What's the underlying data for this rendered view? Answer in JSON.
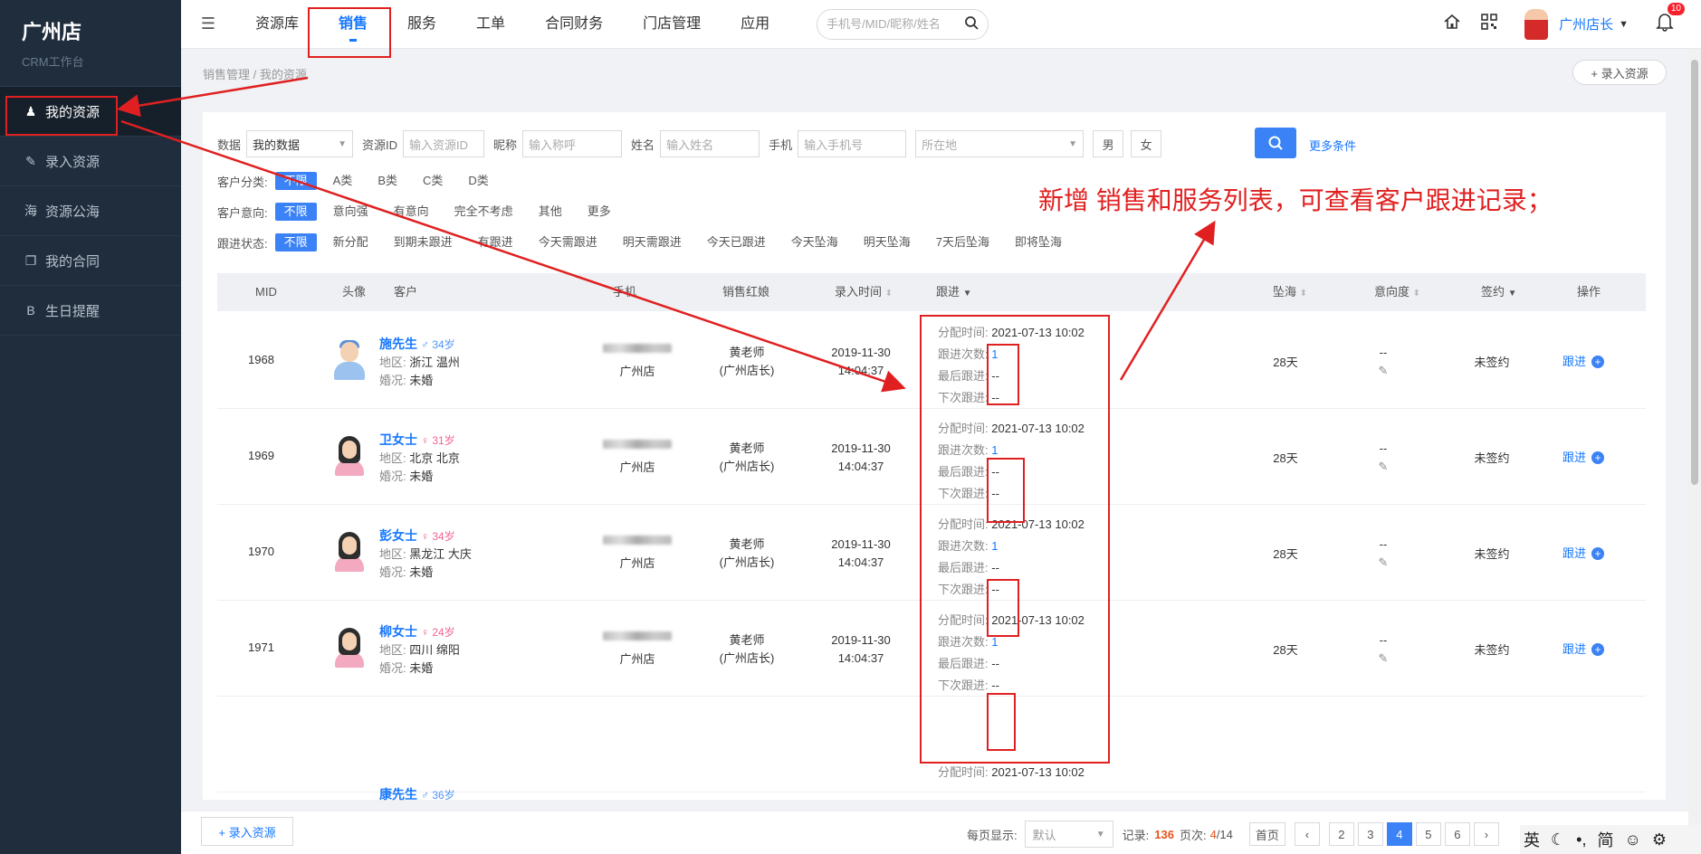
{
  "brand": {
    "title": "广州店",
    "subtitle": "CRM工作台"
  },
  "sidebar": {
    "items": [
      {
        "label": "我的资源",
        "icon": "user-icon",
        "glyph": "♟"
      },
      {
        "label": "录入资源",
        "icon": "edit-icon",
        "glyph": "✎"
      },
      {
        "label": "资源公海",
        "icon": "sea-icon",
        "glyph": "海"
      },
      {
        "label": "我的合同",
        "icon": "contract-icon",
        "glyph": "❐"
      },
      {
        "label": "生日提醒",
        "icon": "birthday-icon",
        "glyph": "B"
      }
    ]
  },
  "topnav": {
    "tabs": [
      "资源库",
      "销售",
      "服务",
      "工单",
      "合同财务",
      "门店管理",
      "应用"
    ],
    "search_placeholder": "手机号/MID/昵称/姓名",
    "user_name": "广州店长",
    "notification_count": "10"
  },
  "breadcrumb": "销售管理 / 我的资源",
  "add_resource_top": "+ 录入资源",
  "filters": {
    "data_label": "数据",
    "data_value": "我的数据",
    "resource_id_label": "资源ID",
    "resource_id_placeholder": "输入资源ID",
    "nickname_label": "昵称",
    "nickname_placeholder": "输入称呼",
    "name_label": "姓名",
    "name_placeholder": "输入姓名",
    "phone_label": "手机",
    "phone_placeholder": "输入手机号",
    "location_placeholder": "所在地",
    "male": "男",
    "female": "女",
    "more": "更多条件",
    "category_label": "客户分类:",
    "categories": [
      "不限",
      "A类",
      "B类",
      "C类",
      "D类"
    ],
    "intent_label": "客户意向:",
    "intents": [
      "不限",
      "意向强",
      "有意向",
      "完全不考虑",
      "其他",
      "更多"
    ],
    "status_label": "跟进状态:",
    "statuses": [
      "不限",
      "新分配",
      "到期未跟进",
      "有跟进",
      "今天需跟进",
      "明天需跟进",
      "今天已跟进",
      "今天坠海",
      "明天坠海",
      "7天后坠海",
      "即将坠海"
    ]
  },
  "table": {
    "headers": {
      "mid": "MID",
      "avatar": "头像",
      "customer": "客户",
      "phone": "手机",
      "sales": "销售红娘",
      "entry_time": "录入时间",
      "follow": "跟进",
      "sea": "坠海",
      "intent": "意向度",
      "sign": "签约",
      "ops": "操作"
    },
    "region_label": "地区:",
    "marital_label": "婚况:",
    "follow_labels": {
      "assigned": "分配时间:",
      "count": "跟进次数:",
      "last": "最后跟进:",
      "next": "下次跟进:"
    },
    "op_label": "跟进",
    "rows": [
      {
        "mid": "1968",
        "gender": "m",
        "name": "施先生",
        "age": "♂ 34岁",
        "region": "浙江 温州",
        "marital": "未婚",
        "store": "广州店",
        "sales": "黄老师",
        "sales_role": "(广州店长)",
        "date": "2019-11-30",
        "time": "14:04:37",
        "assigned": "2021-07-13 10:02",
        "count": "1",
        "last": "--",
        "next": "--",
        "sea": "28天",
        "intent": "--",
        "sign": "未签约"
      },
      {
        "mid": "1969",
        "gender": "f",
        "name": "卫女士",
        "age": "♀ 31岁",
        "region": "北京 北京",
        "marital": "未婚",
        "store": "广州店",
        "sales": "黄老师",
        "sales_role": "(广州店长)",
        "date": "2019-11-30",
        "time": "14:04:37",
        "assigned": "2021-07-13 10:02",
        "count": "1",
        "last": "--",
        "next": "--",
        "sea": "28天",
        "intent": "--",
        "sign": "未签约"
      },
      {
        "mid": "1970",
        "gender": "f",
        "name": "彭女士",
        "age": "♀ 34岁",
        "region": "黑龙江 大庆",
        "marital": "未婚",
        "store": "广州店",
        "sales": "黄老师",
        "sales_role": "(广州店长)",
        "date": "2019-11-30",
        "time": "14:04:37",
        "assigned": "2021-07-13 10:02",
        "count": "1",
        "last": "--",
        "next": "--",
        "sea": "28天",
        "intent": "--",
        "sign": "未签约"
      },
      {
        "mid": "1971",
        "gender": "f",
        "name": "柳女士",
        "age": "♀ 24岁",
        "region": "四川 绵阳",
        "marital": "未婚",
        "store": "广州店",
        "sales": "黄老师",
        "sales_role": "(广州店长)",
        "date": "2019-11-30",
        "time": "14:04:37",
        "assigned": "2021-07-13 10:02",
        "count": "1",
        "last": "--",
        "next": "--",
        "sea": "28天",
        "intent": "--",
        "sign": "未签约"
      },
      {
        "mid": "",
        "gender": "m",
        "name": "康先生",
        "age": "♂ 36岁",
        "assigned": "2021-07-13 10:02"
      }
    ]
  },
  "footer": {
    "add_resource": "+ 录入资源",
    "per_page_label": "每页显示:",
    "per_page_value": "默认",
    "records_label": "记录:",
    "records_value": "136",
    "page_label": "页次:",
    "page_current": "4",
    "page_total": "/14",
    "first": "首页",
    "pages": [
      "2",
      "3",
      "4",
      "5",
      "6"
    ],
    "current_page": "4"
  },
  "ime": {
    "lang": "英",
    "simplified": "简"
  },
  "annotation": {
    "text": "新增 销售和服务列表，可查看客户跟进记录；",
    "color": "#e02020"
  },
  "colors": {
    "accent": "#1677ff",
    "primary_button": "#3b82f6",
    "sidebar_bg": "#1f2d3d",
    "annotation": "#e02020"
  }
}
